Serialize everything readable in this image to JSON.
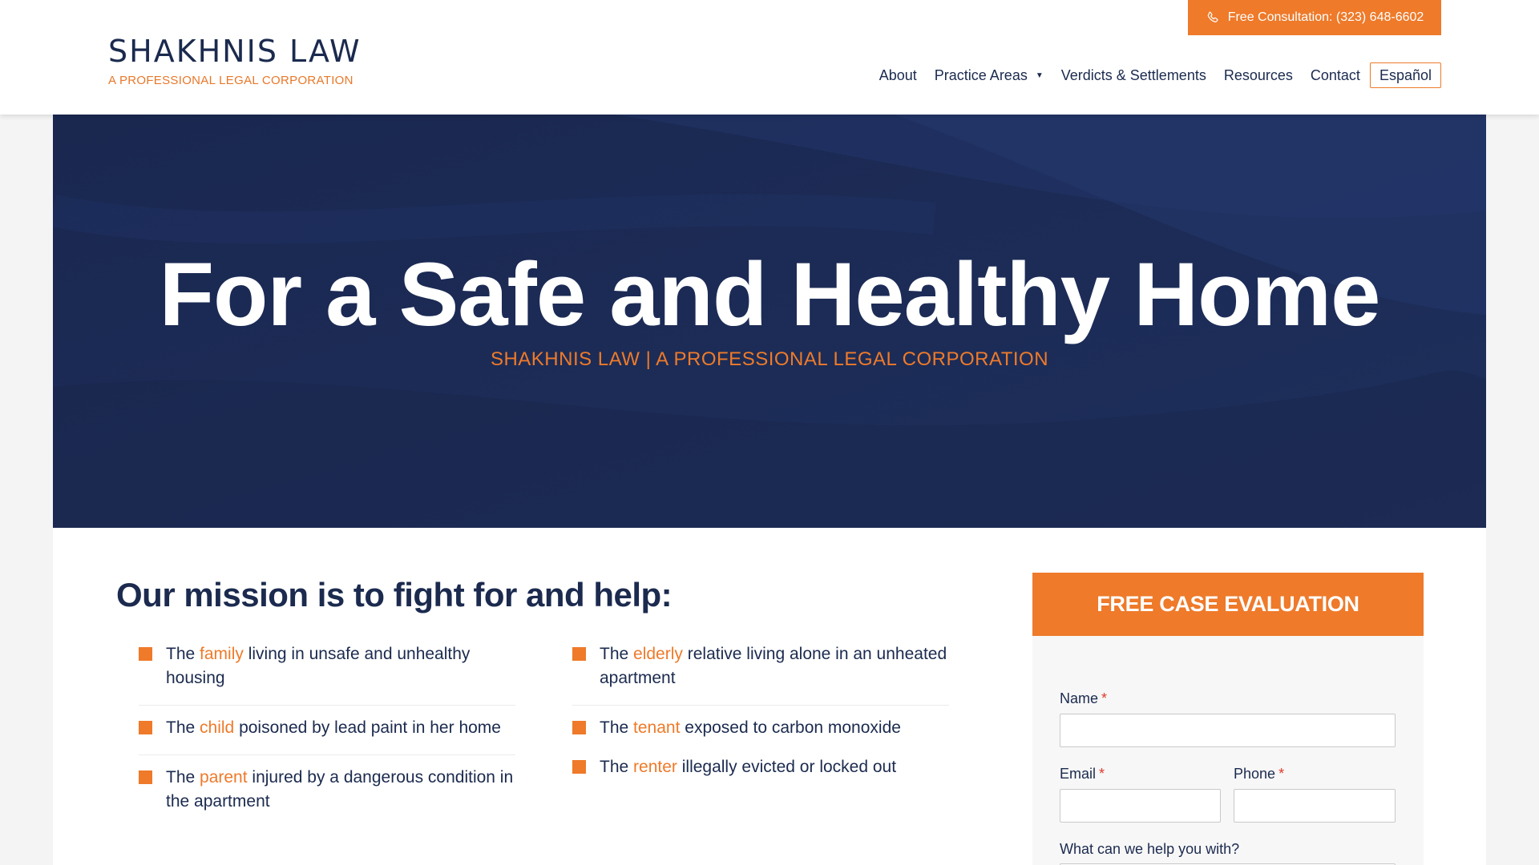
{
  "header": {
    "logo_name": "SHAKHNIS LAW",
    "logo_sub": "A PROFESSIONAL LEGAL CORPORATION",
    "consult_label": "Free Consultation: (323) 648-6602",
    "nav": {
      "about": "About",
      "practice": "Practice Areas",
      "verdicts": "Verdicts & Settlements",
      "resources": "Resources",
      "contact": "Contact",
      "espanol": "Español"
    }
  },
  "hero": {
    "title": "For a Safe and Healthy Home",
    "subtitle": "SHAKHNIS LAW | A PROFESSIONAL LEGAL CORPORATION"
  },
  "mission": {
    "title": "Our mission is to fight for and help:",
    "left": [
      {
        "pre": "The",
        "highlight": "family",
        "post": "living in unsafe and unhealthy housing"
      },
      {
        "pre": "The",
        "highlight": "child",
        "post": "poisoned by lead paint in her home"
      },
      {
        "pre": "The",
        "highlight": "parent",
        "post": "injured by a dangerous condition in the apartment"
      }
    ],
    "right": [
      {
        "pre": "The",
        "highlight": "elderly",
        "post": "relative living alone in an unheated apartment"
      },
      {
        "pre": "The",
        "highlight": "tenant",
        "post": "exposed to carbon monoxide"
      },
      {
        "pre": "The",
        "highlight": "renter",
        "post": "illegally evicted or locked out"
      }
    ]
  },
  "form": {
    "title": "FREE CASE EVALUATION",
    "name_label": "Name",
    "email_label": "Email",
    "phone_label": "Phone",
    "help_label": "What can we help you with?",
    "required_mark": "*"
  },
  "colors": {
    "navy": "#1c2b56",
    "orange": "#ee7a2a",
    "required": "#e0392b"
  }
}
